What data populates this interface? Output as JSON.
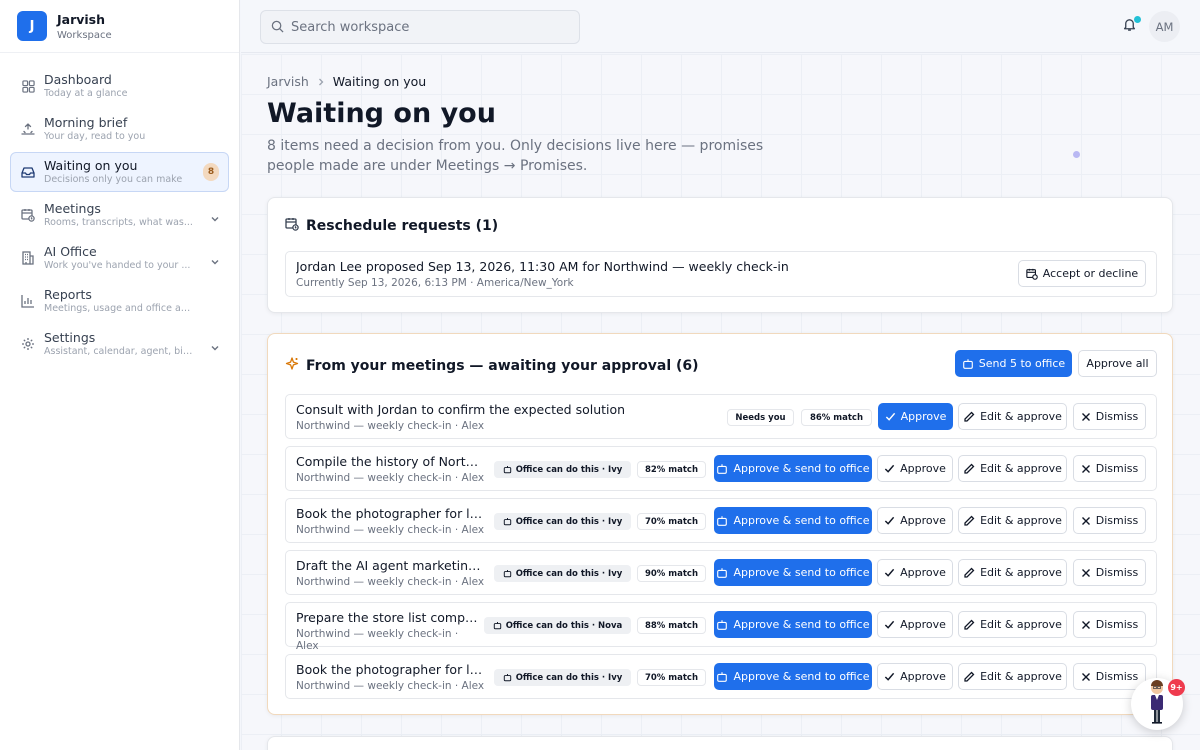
{
  "brand": {
    "initial": "J",
    "name": "Jarvish",
    "sub": "Workspace"
  },
  "sidebar": {
    "items": [
      {
        "label": "Dashboard",
        "sub": "Today at a glance",
        "icon": "grid-icon"
      },
      {
        "label": "Morning brief",
        "sub": "Your day, read to you",
        "icon": "sunrise-icon"
      },
      {
        "label": "Waiting on you",
        "sub": "Decisions only you can make",
        "icon": "inbox-icon",
        "badge": "8",
        "active": true
      },
      {
        "label": "Meetings",
        "sub": "Rooms, transcripts, what was...",
        "icon": "calendar-clock-icon",
        "chevron": true
      },
      {
        "label": "AI Office",
        "sub": "Work you've handed to your ...",
        "icon": "building-icon",
        "chevron": true
      },
      {
        "label": "Reports",
        "sub": "Meetings, usage and office activity",
        "icon": "bar-chart-icon"
      },
      {
        "label": "Settings",
        "sub": "Assistant, calendar, agent, bil...",
        "icon": "gear-icon",
        "chevron": true
      }
    ]
  },
  "topbar": {
    "search_placeholder": "Search workspace",
    "avatar": "AM"
  },
  "breadcrumb": {
    "root": "Jarvish",
    "current": "Waiting on you"
  },
  "page": {
    "title": "Waiting on you",
    "subtitle": "8 items need a decision from you. Only decisions live here — promises people made are under Meetings → Promises."
  },
  "reschedule": {
    "title": "Reschedule requests (1)",
    "item": {
      "title": "Jordan Lee proposed Sep 13, 2026, 11:30 AM for Northwind — weekly check-in",
      "sub": "Currently Sep 13, 2026, 6:13 PM · America/New_York",
      "action": "Accept or decline"
    }
  },
  "approvals": {
    "title": "From your meetings — awaiting your approval (6)",
    "send_label": "Send 5 to office",
    "approve_all_label": "Approve all",
    "buttons": {
      "approve": "Approve",
      "approve_send": "Approve & send to office",
      "edit": "Edit & approve",
      "dismiss": "Dismiss"
    },
    "rows": [
      {
        "title": "Consult with Jordan to confirm the expected solution",
        "sub": "Northwind — weekly check-in · Alex",
        "chip": "Needs you",
        "match": "86% match"
      },
      {
        "title": "Compile the history of Northwi...",
        "sub": "Northwind — weekly check-in · Alex",
        "chip": "Office can do this · Ivy",
        "match": "82% match"
      },
      {
        "title": "Book the photographer for lau...",
        "sub": "Northwind — weekly check-in · Alex",
        "chip": "Office can do this · Ivy",
        "match": "70% match"
      },
      {
        "title": "Draft the AI agent marketing p...",
        "sub": "Northwind — weekly check-in · Alex",
        "chip": "Office can do this · Ivy",
        "match": "90% match"
      },
      {
        "title": "Prepare the store list compar...",
        "sub": "Northwind — weekly check-in · Alex",
        "chip": "Office can do this · Nova",
        "match": "88% match"
      },
      {
        "title": "Book the photographer for lau...",
        "sub": "Northwind — weekly check-in · Alex",
        "chip": "Office can do this · Ivy",
        "match": "70% match"
      }
    ]
  },
  "assistant": {
    "badge": "9+"
  },
  "colors": {
    "accent": "#1f6feb",
    "badge": "#ef3b4e",
    "active_bg": "#eef4ff"
  }
}
